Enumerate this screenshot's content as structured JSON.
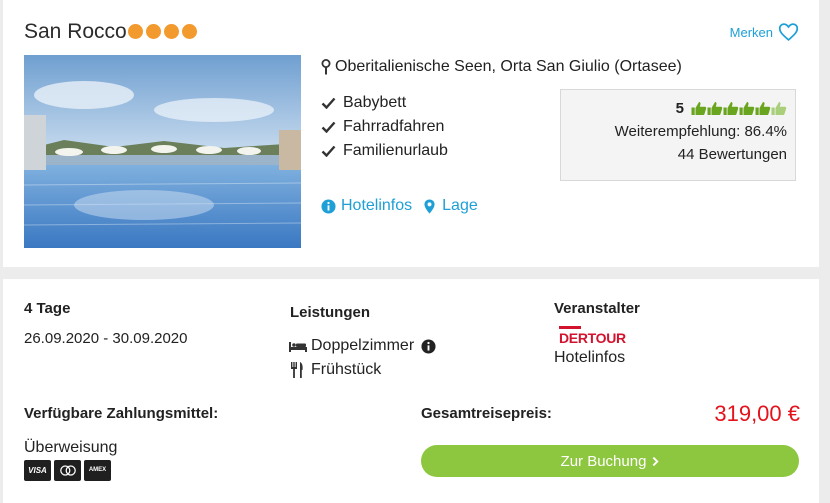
{
  "hotel": {
    "name": "San Rocco",
    "star_count": 4,
    "star_color": "#f39a2e",
    "location": "Oberitalienische Seen, Orta San Giulio (Ortasee)",
    "features": [
      "Babybett",
      "Fahrradfahren",
      "Familienurlaub"
    ],
    "links": {
      "info": "Hotelinfos",
      "map": "Lage"
    },
    "merken_label": "Merken"
  },
  "rating": {
    "score": "5",
    "recommendation": "Weiterempfehlung: 86.4%",
    "reviews": "44 Bewertungen",
    "thumb_count": 6,
    "thumb_color": "#6aa51f"
  },
  "offer": {
    "duration": "4 Tage",
    "dates": "26.09.2020 - 30.09.2020",
    "services_label": "Leistungen",
    "room": "Doppelzimmer",
    "meal": "Frühstück",
    "operator_label": "Veranstalter",
    "operator_logo": "DERTOUR",
    "operator_link": "Hotelinfos",
    "payment_label": "Verfügbare Zahlungsmittel:",
    "payment_method": "Überweisung",
    "payment_icons": [
      "VISA",
      "MC",
      "AMEX"
    ],
    "total_label": "Gesamtreisepreis:",
    "price": "319,00 €",
    "booking_button": "Zur Buchung"
  },
  "colors": {
    "accent": "#1ea0d6",
    "price": "#e3121b",
    "button": "#8dc63f"
  }
}
